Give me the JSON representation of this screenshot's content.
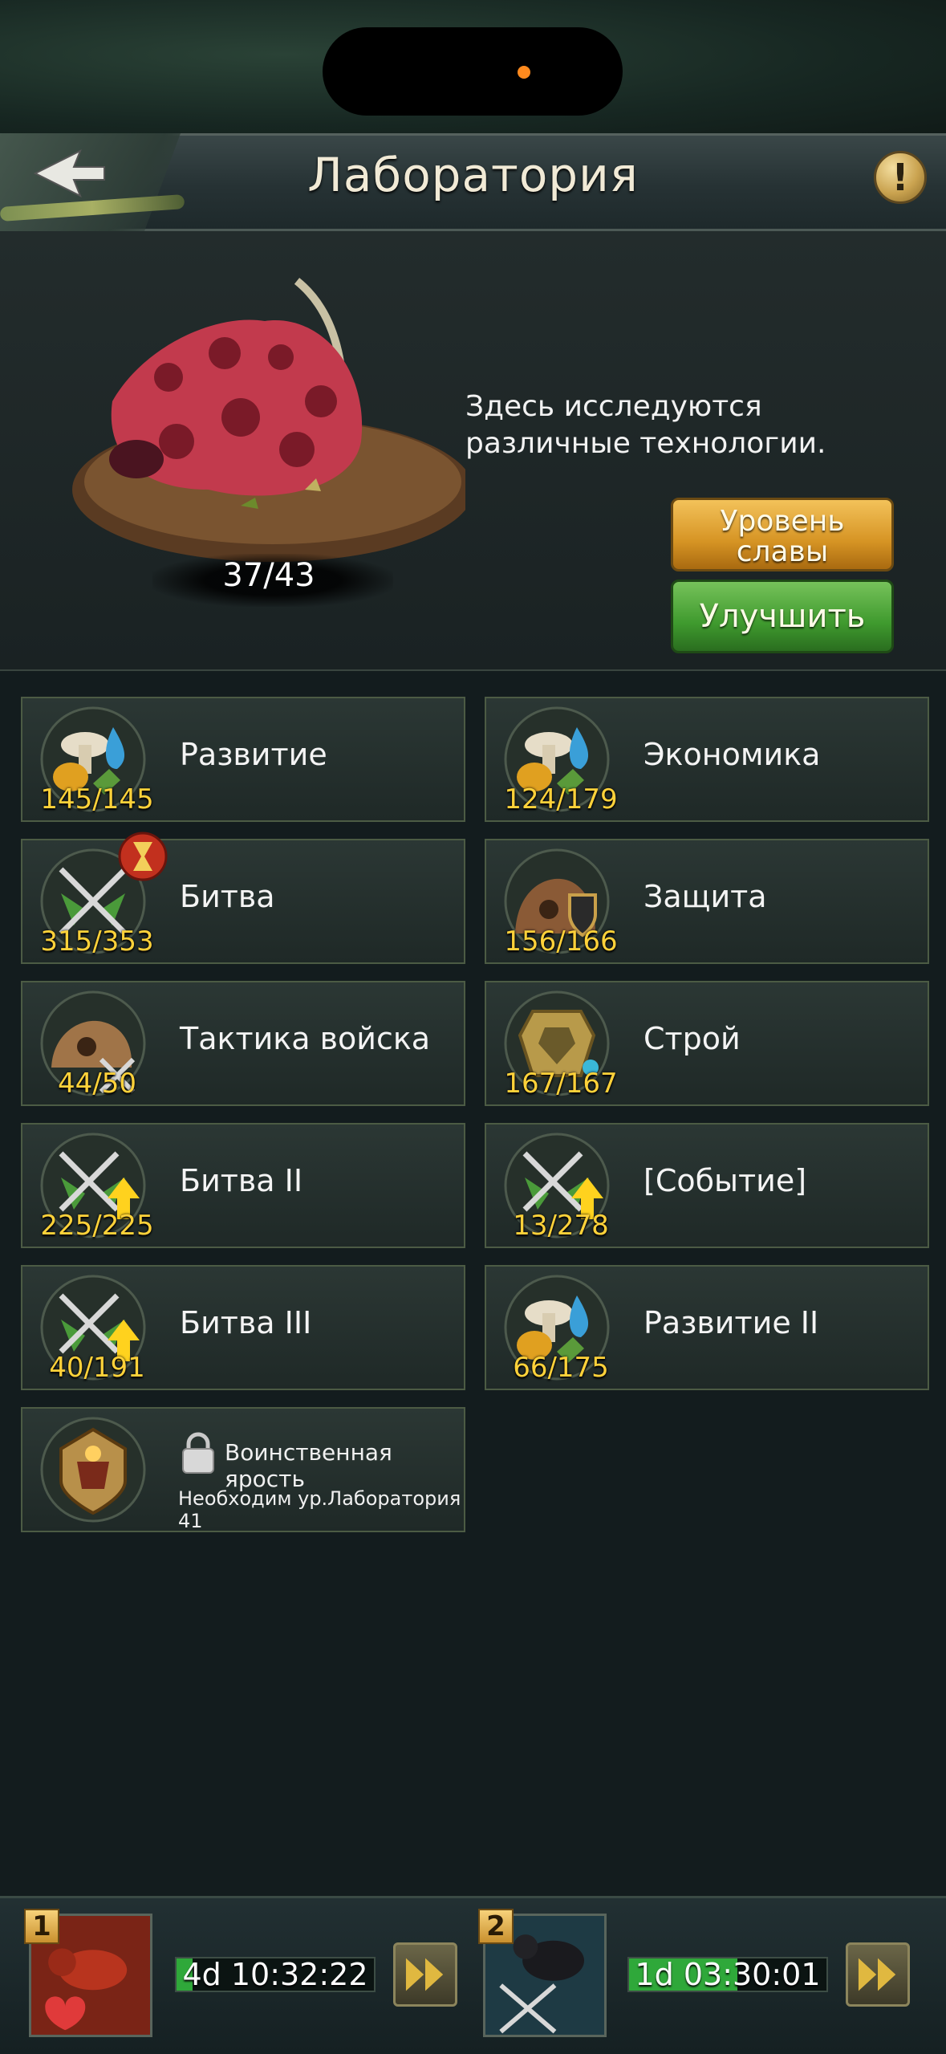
{
  "header": {
    "title": "Лаборатория"
  },
  "building": {
    "level": "37/43",
    "description": "Здесь исследуются различные технологии.",
    "glory_button": "Уровень славы",
    "upgrade_button": "Улучшить"
  },
  "tiles": [
    {
      "label": "Развитие",
      "count": "145/145",
      "icon": "resources-icon"
    },
    {
      "label": "Экономика",
      "count": "124/179",
      "icon": "resources-icon"
    },
    {
      "label": "Битва",
      "count": "315/353",
      "icon": "crossed-swords-icon"
    },
    {
      "label": "Защита",
      "count": "156/166",
      "icon": "anthill-shield-icon"
    },
    {
      "label": "Тактика войска",
      "count": "44/50",
      "icon": "anthill-swords-icon"
    },
    {
      "label": "Строй",
      "count": "167/167",
      "icon": "formation-emblem-icon"
    },
    {
      "label": "Битва II",
      "count": "225/225",
      "icon": "swords-upgrade-icon"
    },
    {
      "label": "[Событие]",
      "count": "13/278",
      "icon": "swords-upgrade-icon"
    },
    {
      "label": "Битва III",
      "count": "40/191",
      "icon": "swords-upgrade-icon"
    },
    {
      "label": "Развитие II",
      "count": "66/175",
      "icon": "resources-icon"
    }
  ],
  "locked_tile": {
    "title": "Воинственная ярость",
    "requirement": "Необходим ур.Лаборатория 41",
    "icon": "war-rage-emblem-icon"
  },
  "queues": [
    {
      "number": "1",
      "timer": "4d 10:32:22",
      "progress": 0.08,
      "icon": "fire-ant-icon"
    },
    {
      "number": "2",
      "timer": "1d 03:30:01",
      "progress": 0.55,
      "icon": "black-ant-swords-icon"
    }
  ],
  "colors": {
    "background": "#131c1e",
    "count_text": "#ffd23a",
    "glory_button": "#d69424",
    "upgrade_button": "#3f9a2e",
    "timer_fill": "#2fa83a"
  }
}
